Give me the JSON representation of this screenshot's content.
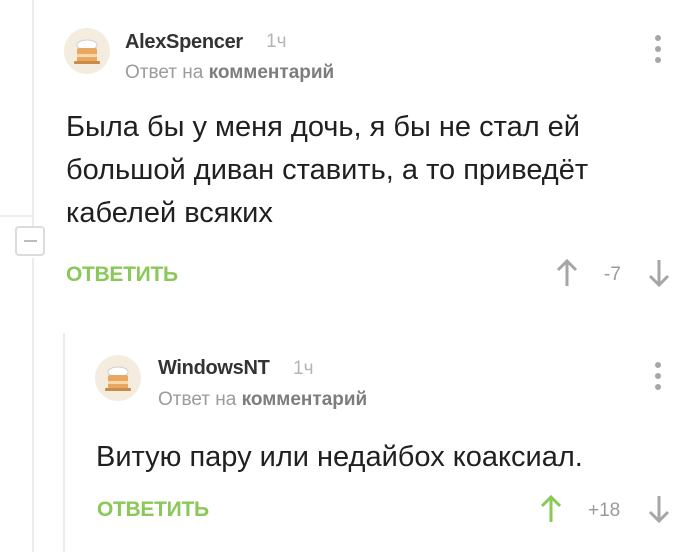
{
  "comment1": {
    "author": "AlexSpencer",
    "time": "1ч",
    "reply_prefix": "Ответ на",
    "reply_target": "комментарий",
    "text_lines": [
      "Была бы у меня дочь, я бы не стал ей",
      "большой диван ставить, а то приведёт",
      "кабелей всяких"
    ],
    "reply_label": "ОТВЕТИТЬ",
    "score": "-7",
    "avatar_icon": "cake-avatar-icon"
  },
  "comment2": {
    "author": "WindowsNT",
    "time": "1ч",
    "reply_prefix": "Ответ на",
    "reply_target": "комментарий",
    "text_lines": [
      "Витую пару или недайбох коаксиал."
    ],
    "reply_label": "ОТВЕТИТЬ",
    "score": "+18",
    "avatar_icon": "cake-avatar-icon"
  },
  "colors": {
    "accent_green": "#8ac858",
    "arrow_grey": "#a6a6a6",
    "text_dark": "#202020"
  }
}
